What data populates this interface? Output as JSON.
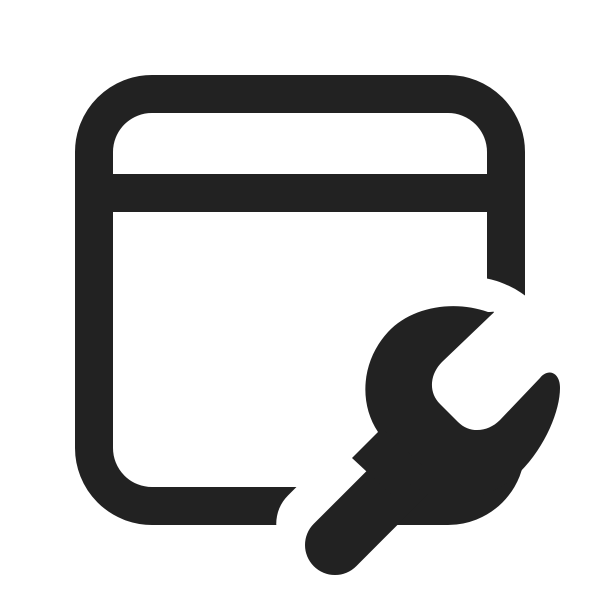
{
  "icon": {
    "name": "window-wrench-icon",
    "parts": [
      "window-frame",
      "title-bar-divider",
      "wrench"
    ],
    "color": "#222222",
    "background": "#ffffff"
  }
}
